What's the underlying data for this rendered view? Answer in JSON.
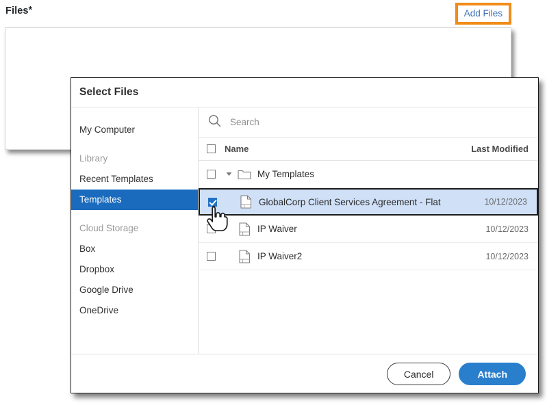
{
  "form": {
    "files_label": "Files",
    "required_marker": "*",
    "add_files_label": "Add Files",
    "accent_orange": "#F28C18",
    "link_blue": "#3b6fb6"
  },
  "dialog": {
    "title": "Select Files",
    "sidebar": [
      {
        "label": "My Computer",
        "type": "item",
        "active": false
      },
      {
        "label": "Library",
        "type": "group"
      },
      {
        "label": "Recent Templates",
        "type": "item",
        "active": false
      },
      {
        "label": "Templates",
        "type": "item",
        "active": true
      },
      {
        "label": "Cloud Storage",
        "type": "group"
      },
      {
        "label": "Box",
        "type": "item",
        "active": false
      },
      {
        "label": "Dropbox",
        "type": "item",
        "active": false
      },
      {
        "label": "Google Drive",
        "type": "item",
        "active": false
      },
      {
        "label": "OneDrive",
        "type": "item",
        "active": false
      }
    ],
    "search": {
      "placeholder": "Search",
      "value": "",
      "icon": "search-icon"
    },
    "table": {
      "columns": {
        "name": "Name",
        "last_modified": "Last Modified"
      },
      "rows": [
        {
          "kind": "folder",
          "name": "My Templates",
          "modified": "",
          "checked": false,
          "selected": false,
          "expanded": true,
          "icon": "folder-icon"
        },
        {
          "kind": "file",
          "name": "GlobalCorp Client Services Agreement - Flat",
          "modified": "10/12/2023",
          "checked": true,
          "selected": true,
          "icon": "document-icon"
        },
        {
          "kind": "file",
          "name": "IP Waiver",
          "modified": "10/12/2023",
          "checked": false,
          "selected": false,
          "icon": "document-icon"
        },
        {
          "kind": "file",
          "name": "IP Waiver2",
          "modified": "10/12/2023",
          "checked": false,
          "selected": false,
          "icon": "document-icon"
        }
      ]
    },
    "footer": {
      "cancel_label": "Cancel",
      "attach_label": "Attach",
      "attach_color": "#2a7fcd"
    }
  },
  "cursor": {
    "type": "pointing-hand-cursor"
  }
}
